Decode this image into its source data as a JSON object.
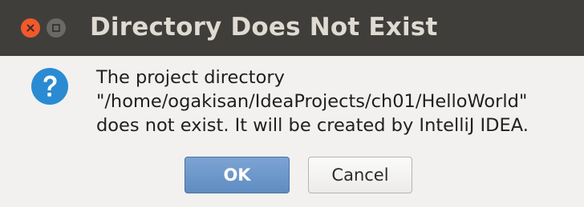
{
  "window": {
    "title": "Directory Does Not Exist"
  },
  "icons": {
    "close": "close-icon",
    "maximize": "maximize-icon",
    "dialog": "question-icon"
  },
  "message": {
    "lines": [
      "The project directory",
      "\"/home/ogakisan/IdeaProjects/ch01/HelloWorld\"",
      "does not exist. It will be created by IntelliJ IDEA."
    ]
  },
  "buttons": {
    "ok_label": "OK",
    "cancel_label": "Cancel"
  },
  "colors": {
    "titlebar": "#403e3b",
    "close_button": "#f05a2b",
    "question_icon": "#2a8bd3",
    "ok_button": "#6b96c9"
  }
}
